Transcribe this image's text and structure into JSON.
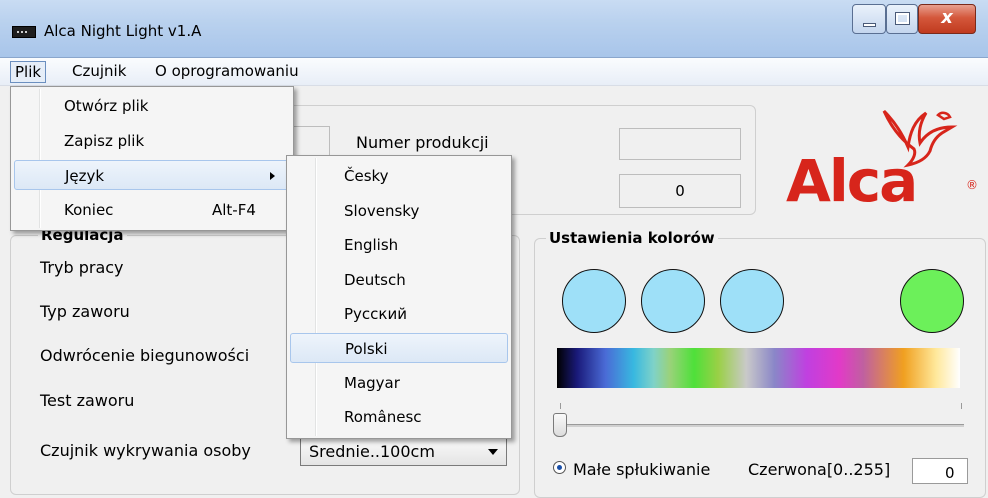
{
  "window": {
    "title": "Alca Night Light  v1.A"
  },
  "window_controls": {
    "close_glyph": "x"
  },
  "menubar": [
    "Plik",
    "Czujnik",
    "O oprogramowaniu"
  ],
  "file_menu": [
    {
      "label": "Otwórz plik",
      "shortcut": ""
    },
    {
      "label": "Zapisz plik",
      "shortcut": ""
    },
    {
      "label": "Język",
      "shortcut": "",
      "submenu": true
    },
    {
      "label": "Koniec",
      "shortcut": "Alt-F4"
    }
  ],
  "language_menu": [
    "Česky",
    "Slovensky",
    "English",
    "Deutsch",
    "Русский",
    "Polski",
    "Magyar",
    "Românesc"
  ],
  "language_highlighted": "Polski",
  "top_panel": {
    "production_label": "Numer produkcji",
    "production_value": "",
    "counter_value": "0"
  },
  "regulation": {
    "title": "Regulacja",
    "labels": [
      "Tryb pracy",
      "Typ zaworu",
      "Odwrócenie biegunowości",
      "Test zaworu",
      "Czujnik wykrywania osoby"
    ],
    "sensor_value": "Srednie..100cm"
  },
  "colors_panel": {
    "title": "Ustawienia kolorów",
    "circle_colors": [
      "#9ee0f8",
      "#9ee0f8",
      "#9ee0f8",
      "#6cf05a"
    ],
    "radio_label": "Małe spłukiwanie",
    "red_label": "Czerwona[0..255]",
    "red_value": "0"
  },
  "logo": {
    "text": "Alca",
    "reg": "®",
    "color": "#d7251b"
  },
  "icons": {
    "app": "app-icon",
    "submenu": "chevron-right-icon",
    "combo": "chevron-down-icon",
    "logo": "bird-logo-icon"
  }
}
